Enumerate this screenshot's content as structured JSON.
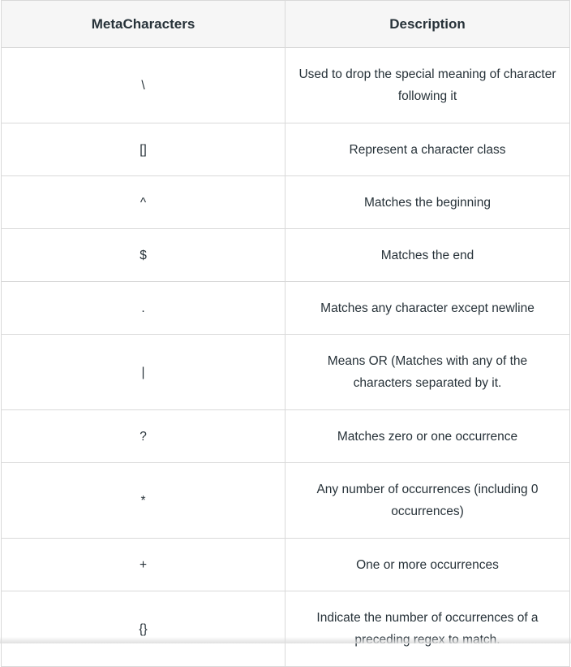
{
  "table": {
    "headers": [
      "MetaCharacters",
      "Description"
    ],
    "rows": [
      {
        "meta": "\\",
        "desc": "Used to drop the special meaning of character following it"
      },
      {
        "meta": "[]",
        "desc": "Represent a character class"
      },
      {
        "meta": "^",
        "desc": "Matches the beginning"
      },
      {
        "meta": "$",
        "desc": "Matches the end"
      },
      {
        "meta": ".",
        "desc": "Matches any character except newline"
      },
      {
        "meta": "|",
        "desc": "Means OR (Matches with any of the characters separated by it."
      },
      {
        "meta": "?",
        "desc": "Matches zero or one occurrence"
      },
      {
        "meta": "*",
        "desc": "Any number of occurrences (including 0 occurrences)"
      },
      {
        "meta": "+",
        "desc": "One or more occurrences"
      },
      {
        "meta": "{}",
        "desc": "Indicate the number of occurrences of a preceding regex to match."
      }
    ]
  }
}
